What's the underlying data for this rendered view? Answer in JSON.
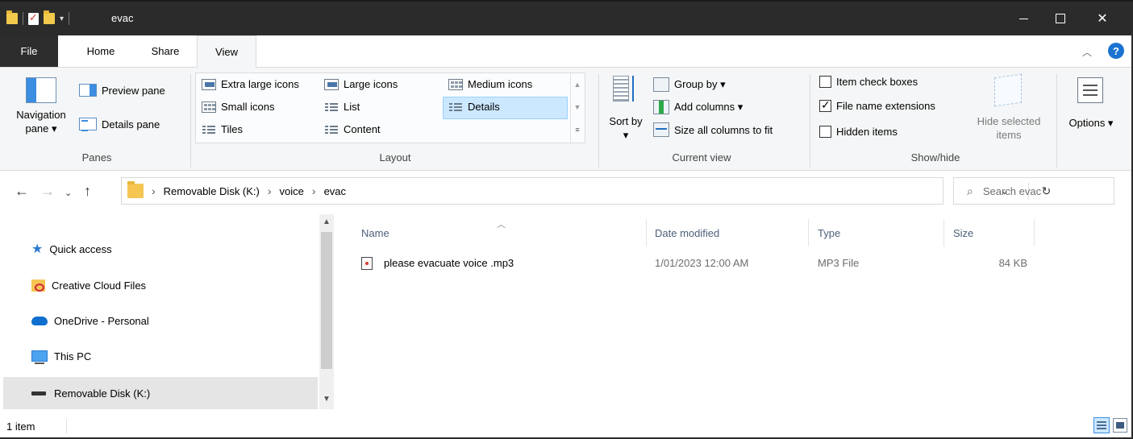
{
  "window": {
    "title": "evac",
    "minimize_icon": "minimize-icon",
    "maximize_icon": "maximize-icon",
    "close_icon": "close-icon"
  },
  "ribbon_tabs": {
    "file": "File",
    "home": "Home",
    "share": "Share",
    "view": "View",
    "active": "View"
  },
  "panes": {
    "navigation_pane": "Navigation pane ▾",
    "preview_pane": "Preview pane",
    "details_pane": "Details pane",
    "group_label": "Panes"
  },
  "layout": {
    "extra_large_icons": "Extra large icons",
    "large_icons": "Large icons",
    "medium_icons": "Medium icons",
    "small_icons": "Small icons",
    "list": "List",
    "details": "Details",
    "tiles": "Tiles",
    "content": "Content",
    "selected": "Details",
    "group_label": "Layout"
  },
  "current_view": {
    "sort_by": "Sort by ▾",
    "group_by": "Group by ▾",
    "add_columns": "Add columns ▾",
    "size_all_columns": "Size all columns to fit",
    "group_label": "Current view"
  },
  "show_hide": {
    "item_check_boxes": {
      "label": "Item check boxes",
      "checked": false
    },
    "file_name_extensions": {
      "label": "File name extensions",
      "checked": true
    },
    "hidden_items": {
      "label": "Hidden items",
      "checked": false
    },
    "hide_selected_items": "Hide selected items",
    "group_label": "Show/hide"
  },
  "options": {
    "label": "Options ▾"
  },
  "address": {
    "breadcrumb": [
      "Removable Disk (K:)",
      "voice",
      "evac"
    ],
    "search_placeholder": "Search evac"
  },
  "navigation": {
    "items": [
      {
        "label": "Quick access",
        "icon": "star-icon"
      },
      {
        "label": "Creative Cloud Files",
        "icon": "creative-cloud-folder-icon"
      },
      {
        "label": "OneDrive - Personal",
        "icon": "cloud-icon"
      },
      {
        "label": "This PC",
        "icon": "computer-icon"
      },
      {
        "label": "Removable Disk (K:)",
        "icon": "removable-disk-icon",
        "selected": true
      }
    ]
  },
  "files": {
    "columns": [
      "Name",
      "Date modified",
      "Type",
      "Size"
    ],
    "rows": [
      {
        "name": "please evacuate voice .mp3",
        "date_modified": "1/01/2023 12:00 AM",
        "type": "MP3 File",
        "size": "84 KB"
      }
    ]
  },
  "status": {
    "item_count": "1 item"
  }
}
